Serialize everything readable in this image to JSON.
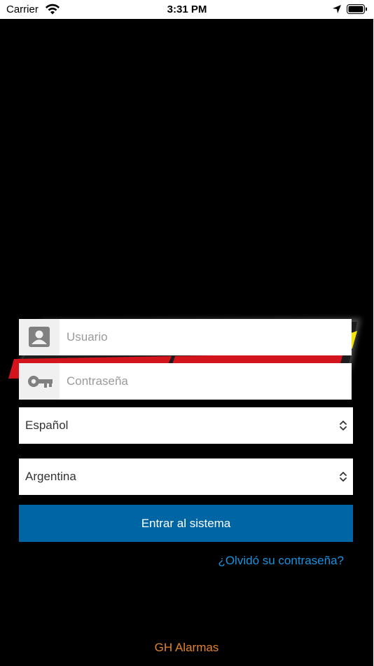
{
  "status_bar": {
    "carrier": "Carrier",
    "time": "3:31 PM",
    "wifi_icon": "wifi-icon",
    "location_icon": "location-arrow-icon",
    "battery_icon": "battery-icon"
  },
  "login": {
    "username": {
      "placeholder": "Usuario",
      "value": "",
      "icon": "user-icon"
    },
    "password": {
      "placeholder": "Contraseña",
      "value": "",
      "icon": "key-icon"
    },
    "language": {
      "selected": "Español",
      "icon": "select-chevron-icon"
    },
    "country": {
      "selected": "Argentina",
      "icon": "select-chevron-icon"
    },
    "submit_label": "Entrar al sistema",
    "forgot_label": "¿Olvidó su contraseña?"
  },
  "footer": {
    "brand": "GH Alarmas"
  },
  "colors": {
    "background": "#000000",
    "primary_button": "#0065a4",
    "link": "#1a92df",
    "footer_text": "#e3822a"
  }
}
